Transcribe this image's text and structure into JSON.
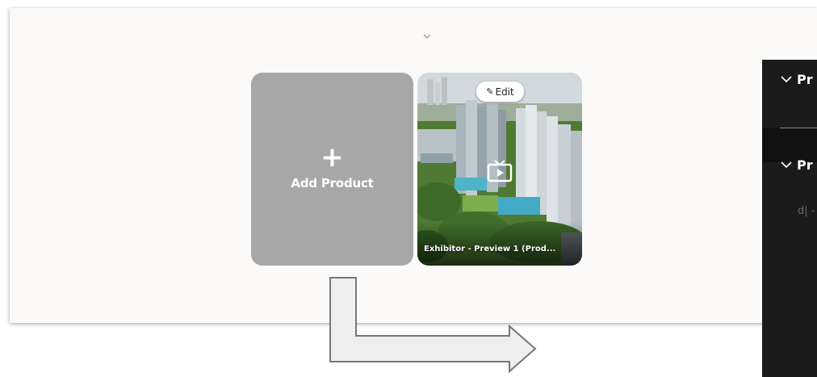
{
  "cards": {
    "add": {
      "plus": "+",
      "label": "Add Product"
    },
    "product": {
      "edit_label": "Edit",
      "title": "Exhibitor - Preview 1 (Prod..."
    }
  },
  "right_panel": {
    "headers": [
      {
        "label": "Pr"
      },
      {
        "label": "Pr"
      }
    ],
    "faint_text": "d| -"
  },
  "icons": {
    "collapse": "chevron-down-icon",
    "edit": "pencil-icon",
    "play": "video-play-icon",
    "panel_headers": "chevron-down-icon"
  },
  "colors": {
    "panel_bg": "#fbfaf8",
    "add_card_bg": "#a7a7a7",
    "right_panel_bg": "#1b1b1b",
    "arrow_fill": "#eeeeee",
    "arrow_stroke": "#777777"
  }
}
